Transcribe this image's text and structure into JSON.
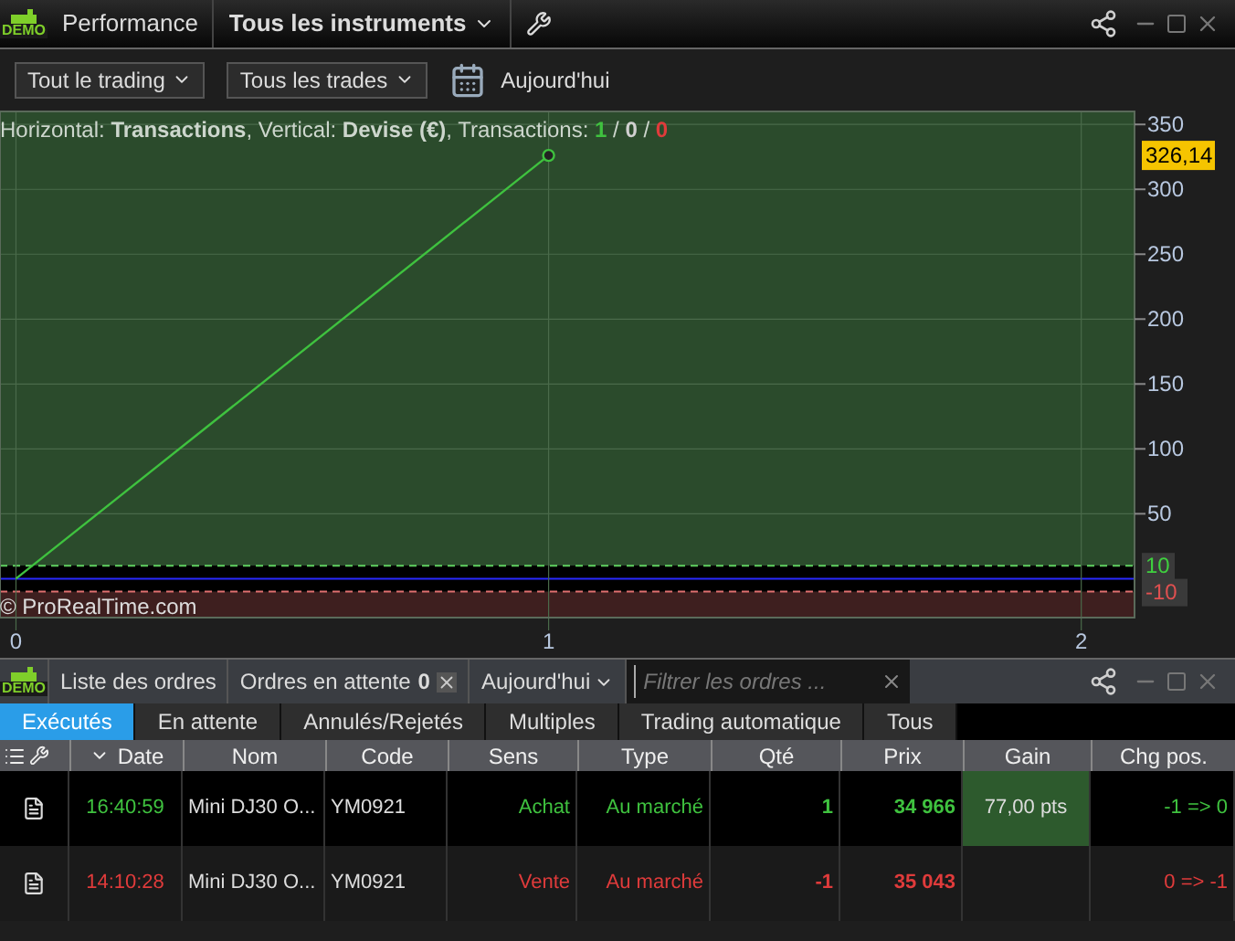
{
  "top_bar": {
    "logo": "DEMO",
    "title": "Performance",
    "instrument_menu": "Tous les instruments"
  },
  "toolbar": {
    "dropdowns": [
      "Tout le trading",
      "Tous les trades"
    ],
    "date_label": "Aujourd'hui"
  },
  "chart": {
    "header": "Horizontal: **Transactions**, Vertical: **Devise (€)**, Transactions: ",
    "counts": [
      {
        "text": "1",
        "color": "#3fc23f"
      },
      {
        "text": "0",
        "color": "#d0d0d0"
      },
      {
        "text": "0",
        "color": "#e03b3b"
      }
    ],
    "count_separator": " / ",
    "last_value_label": "326,14",
    "thresholds": [
      {
        "label": "10",
        "kind": "upper"
      },
      {
        "label": "-10",
        "kind": "lower"
      }
    ],
    "copyright": "© ProRealTime.com",
    "chart_data": {
      "type": "line",
      "x": [
        0,
        1
      ],
      "series": [
        {
          "color": "#3fc23f",
          "values": [
            0,
            326.14
          ]
        }
      ],
      "xticks": [
        0,
        1,
        2
      ],
      "yticks": [
        50,
        100,
        150,
        200,
        250,
        300,
        350
      ],
      "xlim": [
        -0.03,
        2.1
      ],
      "ylim": [
        -30,
        360
      ],
      "grid": true
    }
  },
  "orders_bar": {
    "logo": "DEMO",
    "list_label": "Liste des ordres",
    "pending_label": "Ordres en attente",
    "pending_count": "0",
    "date_menu": "Aujourd'hui",
    "filter": {
      "placeholder": "Filtrer les ordres ..."
    }
  },
  "tabs": [
    {
      "label": "Exécutés",
      "selected": true
    },
    {
      "label": "En attente",
      "selected": false
    },
    {
      "label": "Annulés/Rejetés",
      "selected": false
    },
    {
      "label": "Multiples",
      "selected": false
    },
    {
      "label": "Trading automatique",
      "selected": false
    },
    {
      "label": "Tous",
      "selected": false
    }
  ],
  "table": {
    "columns": [
      "Date",
      "Nom",
      "Code",
      "Sens",
      "Type",
      "Qté",
      "Prix",
      "Gain",
      "Chg pos."
    ],
    "rows": [
      {
        "kind": "buy",
        "cells": [
          "16:40:59",
          "Mini DJ30 O...",
          "YM0921",
          "Achat",
          "Au marché",
          "1",
          "34 966",
          "77,00 pts",
          "-1 => 0"
        ]
      },
      {
        "kind": "sell",
        "cells": [
          "14:10:28",
          "Mini DJ30 O...",
          "YM0921",
          "Vente",
          "Au marché",
          "-1",
          "35 043",
          "",
          "0 => -1"
        ]
      }
    ]
  }
}
